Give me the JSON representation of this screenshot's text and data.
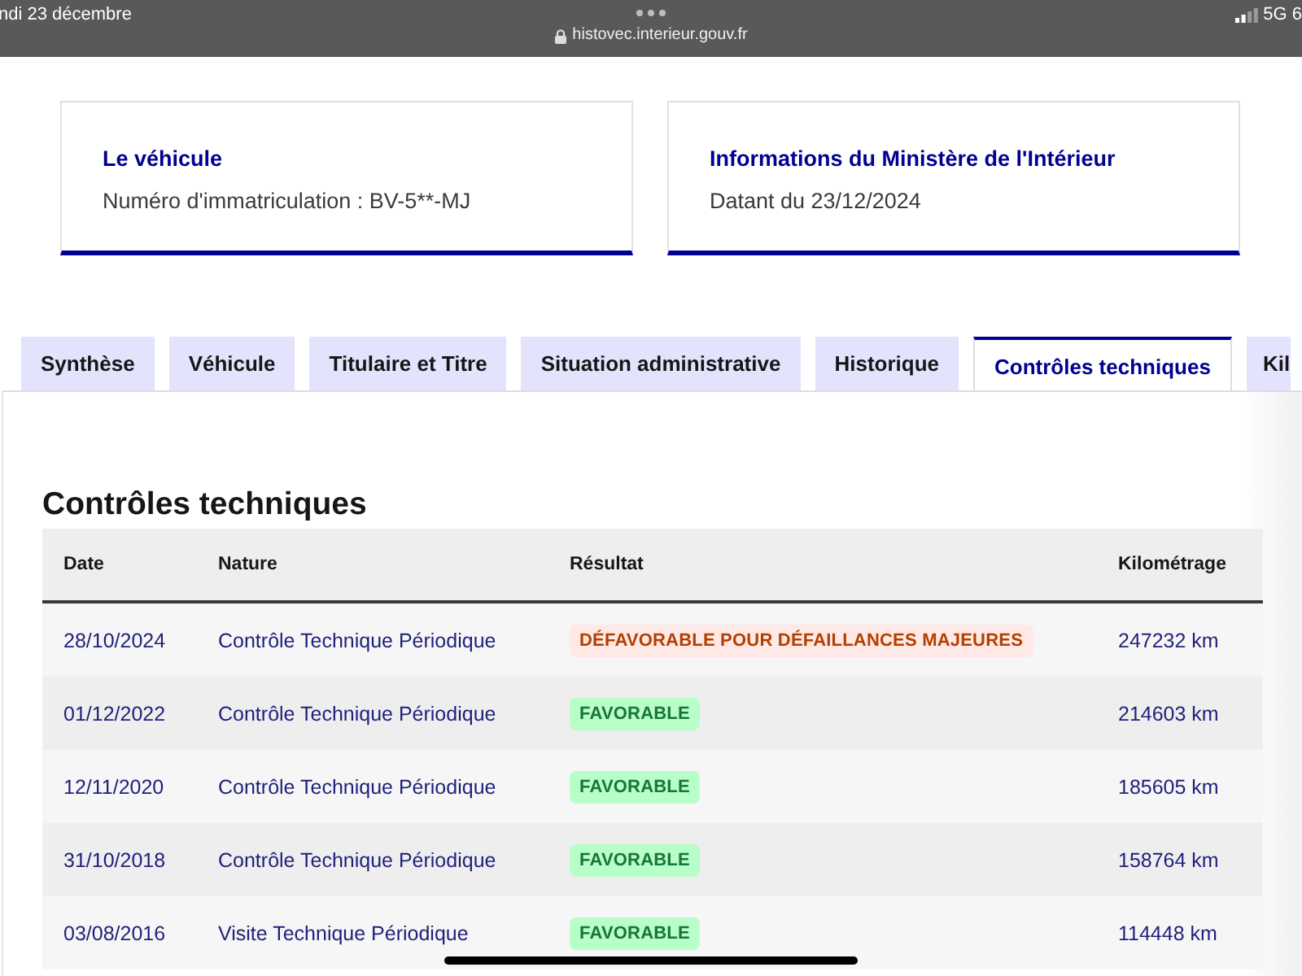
{
  "status_bar": {
    "date": "ndi 23 décembre",
    "url": "histovec.interieur.gouv.fr",
    "network": "5G 6"
  },
  "cards": [
    {
      "title": "Le véhicule",
      "text": "Numéro d'immatriculation : BV-5**-MJ"
    },
    {
      "title": "Informations du Ministère de l'Intérieur",
      "text": "Datant du 23/12/2024"
    }
  ],
  "tabs": [
    {
      "label": "Synthèse",
      "selected": false
    },
    {
      "label": "Véhicule",
      "selected": false
    },
    {
      "label": "Titulaire et Titre",
      "selected": false
    },
    {
      "label": "Situation administrative",
      "selected": false
    },
    {
      "label": "Historique",
      "selected": false
    },
    {
      "label": "Contrôles techniques",
      "selected": true
    },
    {
      "label": "Kil",
      "selected": false
    }
  ],
  "section": {
    "title": "Contrôles techniques",
    "table": {
      "columns": [
        "Date",
        "Nature",
        "Résultat",
        "Kilométrage"
      ],
      "rows": [
        {
          "date": "28/10/2024",
          "nature": "Contrôle Technique Périodique",
          "result": {
            "label": "DÉFAVORABLE POUR DÉFAILLANCES MAJEURES",
            "kind": "error"
          },
          "mileage": "247232 km"
        },
        {
          "date": "01/12/2022",
          "nature": "Contrôle Technique Périodique",
          "result": {
            "label": "FAVORABLE",
            "kind": "success"
          },
          "mileage": "214603 km"
        },
        {
          "date": "12/11/2020",
          "nature": "Contrôle Technique Périodique",
          "result": {
            "label": "FAVORABLE",
            "kind": "success"
          },
          "mileage": "185605 km"
        },
        {
          "date": "31/10/2018",
          "nature": "Contrôle Technique Périodique",
          "result": {
            "label": "FAVORABLE",
            "kind": "success"
          },
          "mileage": "158764 km"
        },
        {
          "date": "03/08/2016",
          "nature": "Visite Technique Périodique",
          "result": {
            "label": "FAVORABLE",
            "kind": "success"
          },
          "mileage": "114448 km"
        }
      ]
    }
  }
}
